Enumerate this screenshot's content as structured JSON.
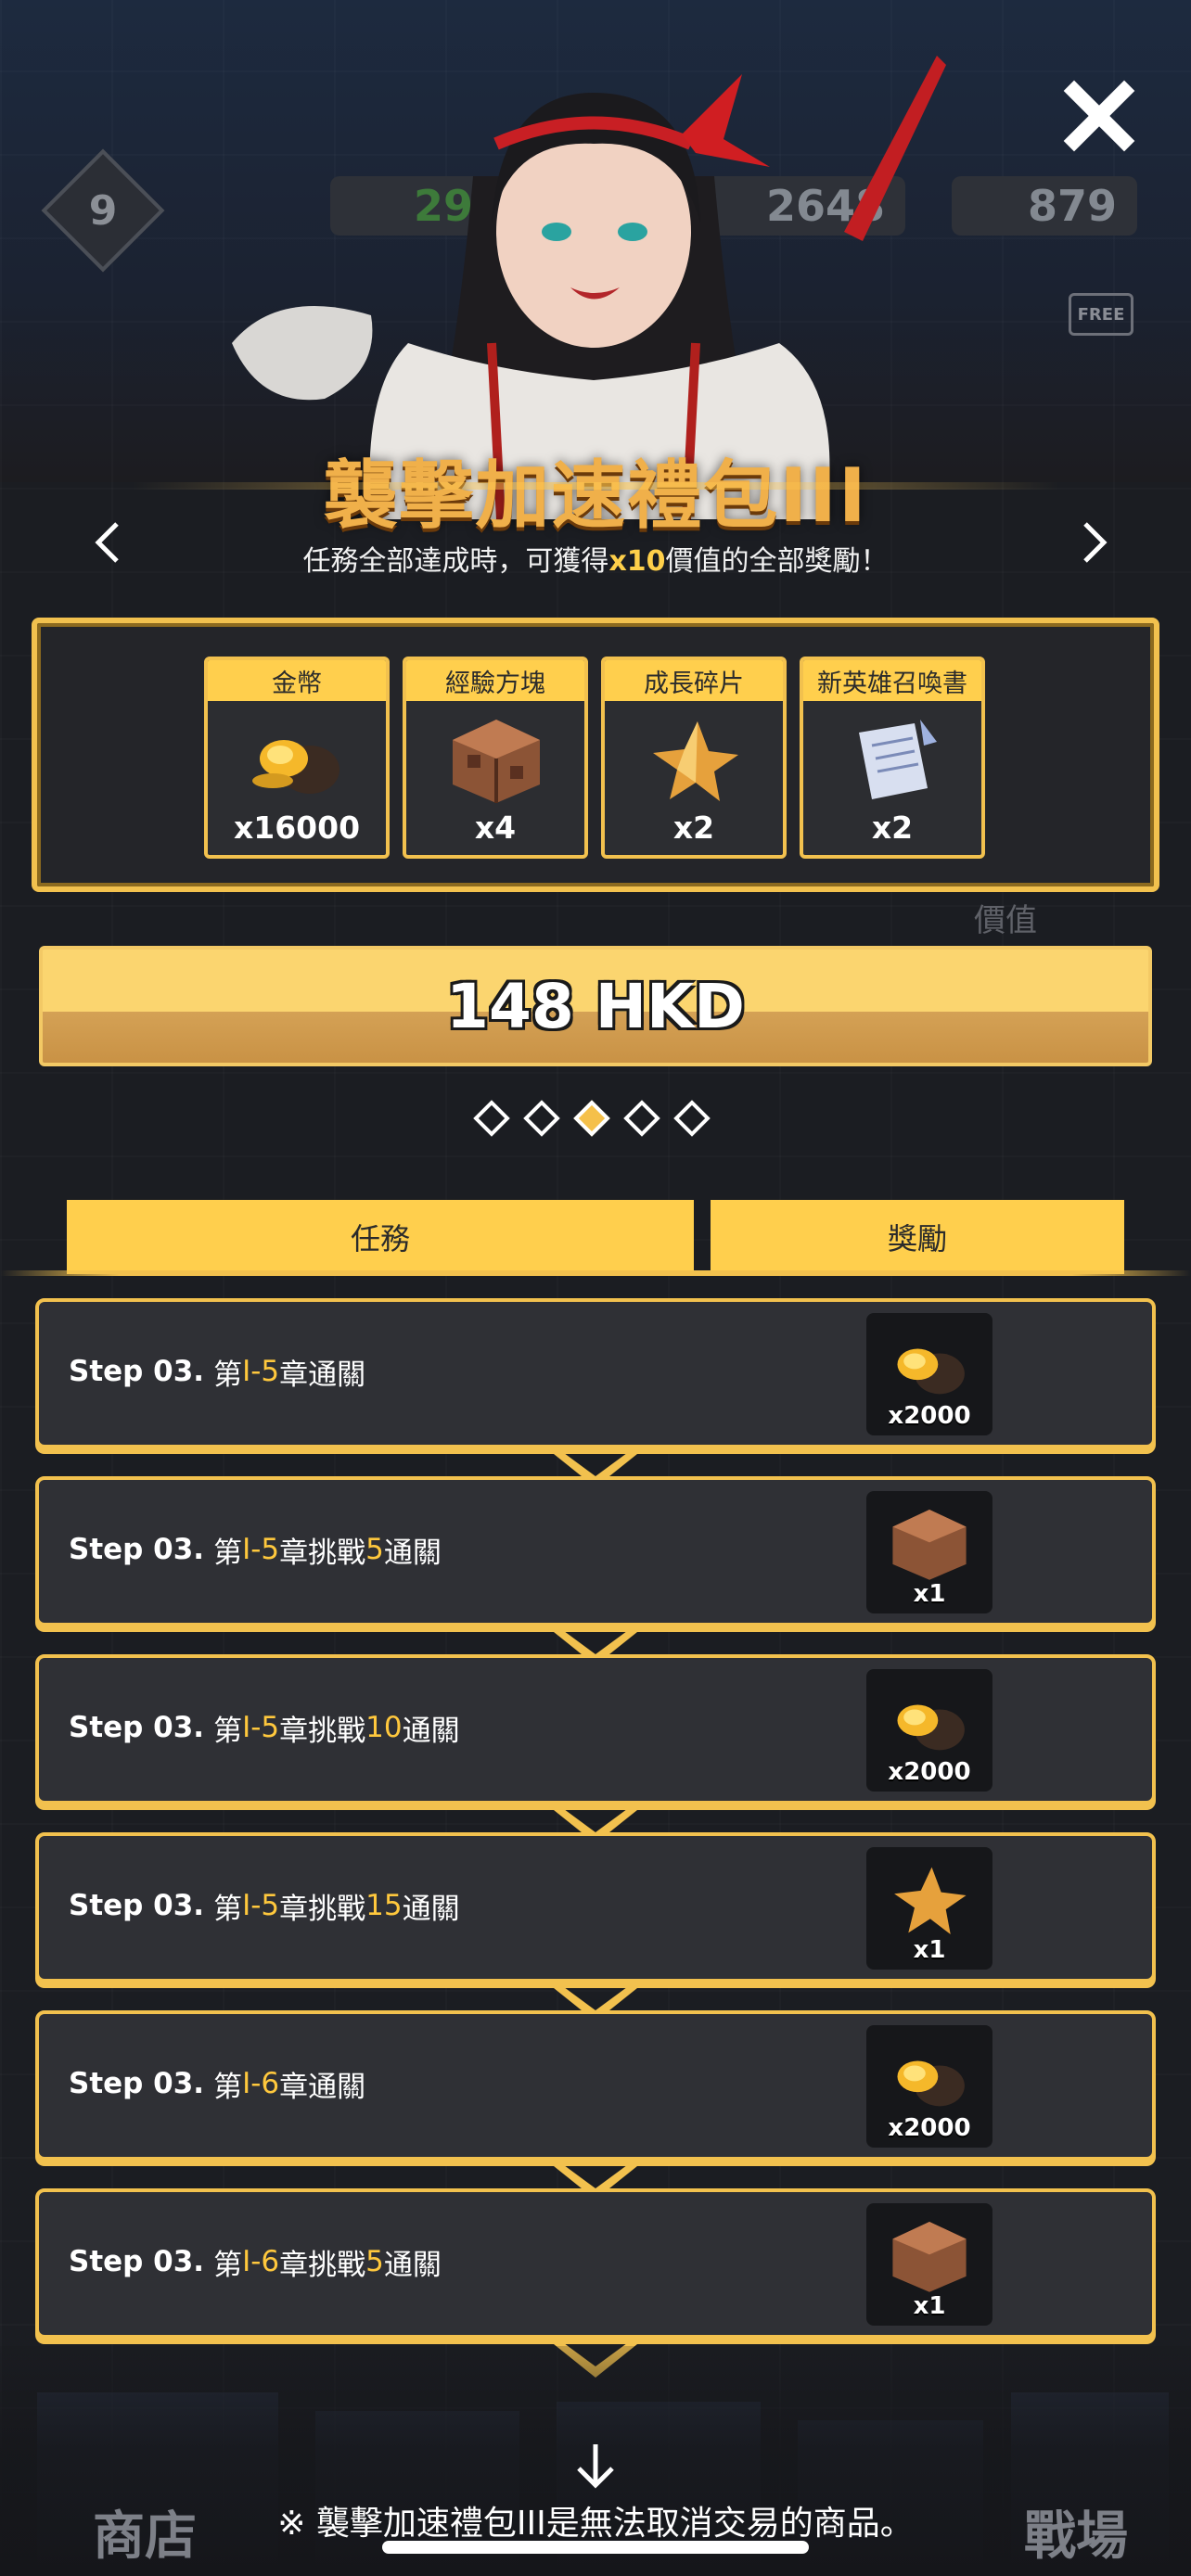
{
  "hud": {
    "level": "9",
    "meat": "297",
    "gold": "2648",
    "gems": "879",
    "free_badge": "FREE"
  },
  "title": "襲擊加速禮包III",
  "subtitle_prefix": "任務全部達成時，可獲得",
  "subtitle_highlight": "x10",
  "subtitle_suffix": "價值的全部獎勵！",
  "rewards": [
    {
      "label": "金幣",
      "qty": "x16000",
      "icon": "gold-coin-bag-icon"
    },
    {
      "label": "經驗方塊",
      "qty": "x4",
      "icon": "exp-cube-icon"
    },
    {
      "label": "成長碎片",
      "qty": "x2",
      "icon": "growth-shard-icon"
    },
    {
      "label": "新英雄召喚書",
      "qty": "x2",
      "icon": "summon-scroll-icon"
    }
  ],
  "value_tag": "價值",
  "price": "148 HKD",
  "pagination": {
    "count": 5,
    "active_index": 2
  },
  "tabs": {
    "tasks": "任務",
    "rewards": "獎勵"
  },
  "steps": [
    {
      "step": "Step 03.",
      "pre": "第",
      "chapter": "I-5",
      "mid": "章通關",
      "num": "",
      "post": "",
      "reward_qty": "x2000",
      "reward_icon": "gold-coin-bag-icon"
    },
    {
      "step": "Step 03.",
      "pre": "第",
      "chapter": "I-5",
      "mid": "章挑戰",
      "num": "5",
      "post": "通關",
      "reward_qty": "x1",
      "reward_icon": "exp-cube-icon"
    },
    {
      "step": "Step 03.",
      "pre": "第",
      "chapter": "I-5",
      "mid": "章挑戰",
      "num": "10",
      "post": "通關",
      "reward_qty": "x2000",
      "reward_icon": "gold-coin-bag-icon"
    },
    {
      "step": "Step 03.",
      "pre": "第",
      "chapter": "I-5",
      "mid": "章挑戰",
      "num": "15",
      "post": "通關",
      "reward_qty": "x1",
      "reward_icon": "growth-shard-icon"
    },
    {
      "step": "Step 03.",
      "pre": "第",
      "chapter": "I-6",
      "mid": "章通關",
      "num": "",
      "post": "",
      "reward_qty": "x2000",
      "reward_icon": "gold-coin-bag-icon"
    },
    {
      "step": "Step 03.",
      "pre": "第",
      "chapter": "I-6",
      "mid": "章挑戰",
      "num": "5",
      "post": "通關",
      "reward_qty": "x1",
      "reward_icon": "exp-cube-icon"
    }
  ],
  "bottom_nav": {
    "left": "商店",
    "right": "戰場"
  },
  "footer_note": "※ 襲擊加速禮包III是無法取消交易的商品。",
  "colors": {
    "accent": "#f2c14e",
    "tab": "#ffcf4d",
    "highlight": "#ffc83d",
    "title": "#f0b04a"
  }
}
